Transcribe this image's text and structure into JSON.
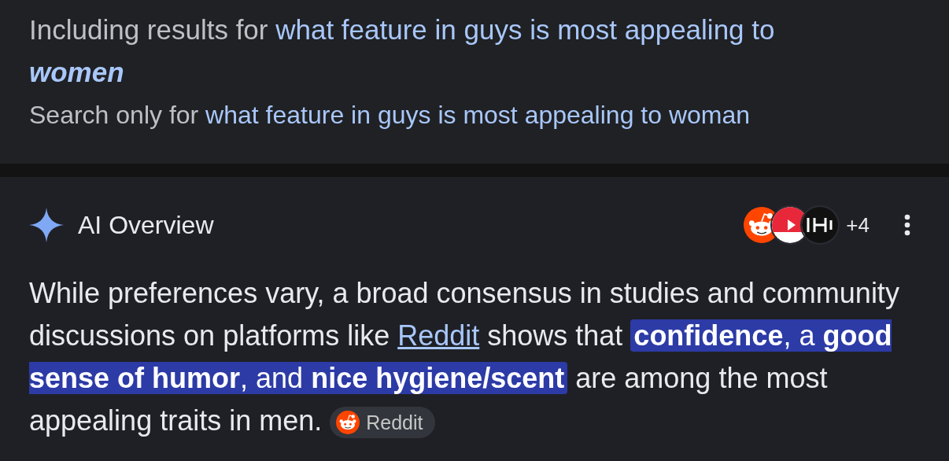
{
  "spelling": {
    "including_prefix": "Including results for",
    "including_query": "what feature in guys is most appealing to",
    "corrected_word": "women",
    "search_only_prefix": "Search only for",
    "search_only_query": "what feature in guys is most appealing to woman"
  },
  "ai_overview": {
    "title": "AI Overview",
    "sources": [
      {
        "kind": "reddit"
      },
      {
        "kind": "youtube"
      },
      {
        "kind": "dumbbell"
      }
    ],
    "more_count": "+4",
    "paragraph": [
      {
        "kind": "plain",
        "text": "While preferences vary, a broad consensus in studies and community discussions on platforms like "
      },
      {
        "kind": "link",
        "text": "Reddit"
      },
      {
        "kind": "plain",
        "text": " shows that "
      },
      {
        "kind": "highlight",
        "text": "**confidence**, a **good sense of humor**, and **nice hygiene/scent**"
      },
      {
        "kind": "plain",
        "text": " are among the most appealing traits in men. "
      }
    ],
    "citation": {
      "label": "Reddit"
    }
  }
}
